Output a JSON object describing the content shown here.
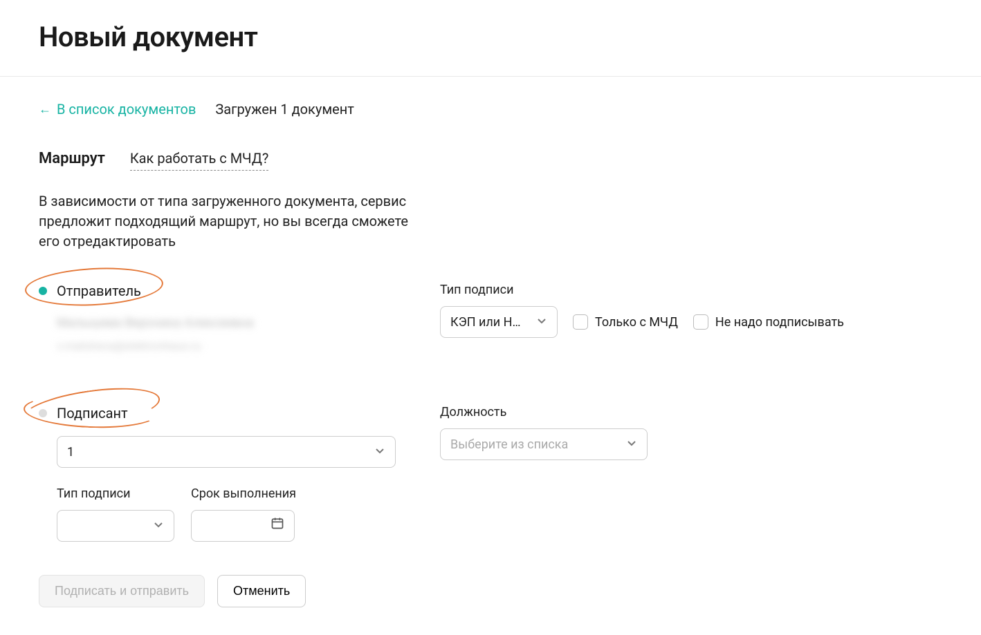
{
  "header": {
    "title": "Новый документ"
  },
  "topline": {
    "back_label": "В список документов",
    "loaded_label": "Загружен 1 документ"
  },
  "route": {
    "title": "Маршрут",
    "help_label": "Как работать с МЧД?",
    "description": "В зависимости от типа загруженного документа, сервис предложит подходящий маршрут, но вы всегда сможете его отредактировать"
  },
  "sender": {
    "label": "Отправитель",
    "name_blur": "Малышева Вероника Алексеевна",
    "email_blur": "v.malisheva@elektronhaus.ru",
    "signature_type_label": "Тип подписи",
    "signature_type_value": "КЭП или Н…",
    "checkbox_mchd": "Только с МЧД",
    "checkbox_nosign": "Не надо подписывать"
  },
  "signer": {
    "label": "Подписант",
    "select_value": "1",
    "position_label": "Должность",
    "position_placeholder": "Выберите из списка",
    "sig_type_label": "Тип подписи",
    "deadline_label": "Срок выполнения"
  },
  "footer": {
    "submit": "Подписать и отправить",
    "cancel": "Отменить"
  }
}
